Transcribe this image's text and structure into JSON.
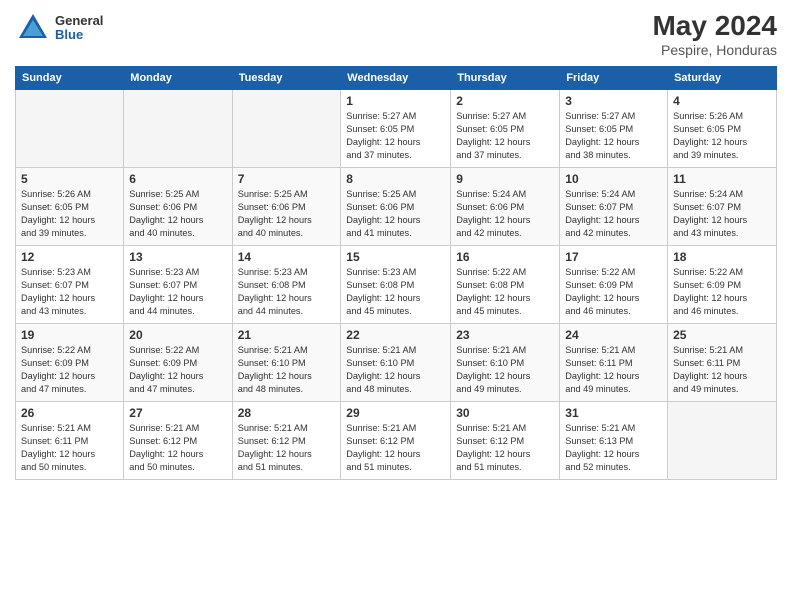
{
  "header": {
    "logo": {
      "general": "General",
      "blue": "Blue"
    },
    "title": "May 2024",
    "location": "Pespire, Honduras"
  },
  "weekdays": [
    "Sunday",
    "Monday",
    "Tuesday",
    "Wednesday",
    "Thursday",
    "Friday",
    "Saturday"
  ],
  "weeks": [
    [
      {
        "day": "",
        "info": ""
      },
      {
        "day": "",
        "info": ""
      },
      {
        "day": "",
        "info": ""
      },
      {
        "day": "1",
        "info": "Sunrise: 5:27 AM\nSunset: 6:05 PM\nDaylight: 12 hours\nand 37 minutes."
      },
      {
        "day": "2",
        "info": "Sunrise: 5:27 AM\nSunset: 6:05 PM\nDaylight: 12 hours\nand 37 minutes."
      },
      {
        "day": "3",
        "info": "Sunrise: 5:27 AM\nSunset: 6:05 PM\nDaylight: 12 hours\nand 38 minutes."
      },
      {
        "day": "4",
        "info": "Sunrise: 5:26 AM\nSunset: 6:05 PM\nDaylight: 12 hours\nand 39 minutes."
      }
    ],
    [
      {
        "day": "5",
        "info": "Sunrise: 5:26 AM\nSunset: 6:05 PM\nDaylight: 12 hours\nand 39 minutes."
      },
      {
        "day": "6",
        "info": "Sunrise: 5:25 AM\nSunset: 6:06 PM\nDaylight: 12 hours\nand 40 minutes."
      },
      {
        "day": "7",
        "info": "Sunrise: 5:25 AM\nSunset: 6:06 PM\nDaylight: 12 hours\nand 40 minutes."
      },
      {
        "day": "8",
        "info": "Sunrise: 5:25 AM\nSunset: 6:06 PM\nDaylight: 12 hours\nand 41 minutes."
      },
      {
        "day": "9",
        "info": "Sunrise: 5:24 AM\nSunset: 6:06 PM\nDaylight: 12 hours\nand 42 minutes."
      },
      {
        "day": "10",
        "info": "Sunrise: 5:24 AM\nSunset: 6:07 PM\nDaylight: 12 hours\nand 42 minutes."
      },
      {
        "day": "11",
        "info": "Sunrise: 5:24 AM\nSunset: 6:07 PM\nDaylight: 12 hours\nand 43 minutes."
      }
    ],
    [
      {
        "day": "12",
        "info": "Sunrise: 5:23 AM\nSunset: 6:07 PM\nDaylight: 12 hours\nand 43 minutes."
      },
      {
        "day": "13",
        "info": "Sunrise: 5:23 AM\nSunset: 6:07 PM\nDaylight: 12 hours\nand 44 minutes."
      },
      {
        "day": "14",
        "info": "Sunrise: 5:23 AM\nSunset: 6:08 PM\nDaylight: 12 hours\nand 44 minutes."
      },
      {
        "day": "15",
        "info": "Sunrise: 5:23 AM\nSunset: 6:08 PM\nDaylight: 12 hours\nand 45 minutes."
      },
      {
        "day": "16",
        "info": "Sunrise: 5:22 AM\nSunset: 6:08 PM\nDaylight: 12 hours\nand 45 minutes."
      },
      {
        "day": "17",
        "info": "Sunrise: 5:22 AM\nSunset: 6:09 PM\nDaylight: 12 hours\nand 46 minutes."
      },
      {
        "day": "18",
        "info": "Sunrise: 5:22 AM\nSunset: 6:09 PM\nDaylight: 12 hours\nand 46 minutes."
      }
    ],
    [
      {
        "day": "19",
        "info": "Sunrise: 5:22 AM\nSunset: 6:09 PM\nDaylight: 12 hours\nand 47 minutes."
      },
      {
        "day": "20",
        "info": "Sunrise: 5:22 AM\nSunset: 6:09 PM\nDaylight: 12 hours\nand 47 minutes."
      },
      {
        "day": "21",
        "info": "Sunrise: 5:21 AM\nSunset: 6:10 PM\nDaylight: 12 hours\nand 48 minutes."
      },
      {
        "day": "22",
        "info": "Sunrise: 5:21 AM\nSunset: 6:10 PM\nDaylight: 12 hours\nand 48 minutes."
      },
      {
        "day": "23",
        "info": "Sunrise: 5:21 AM\nSunset: 6:10 PM\nDaylight: 12 hours\nand 49 minutes."
      },
      {
        "day": "24",
        "info": "Sunrise: 5:21 AM\nSunset: 6:11 PM\nDaylight: 12 hours\nand 49 minutes."
      },
      {
        "day": "25",
        "info": "Sunrise: 5:21 AM\nSunset: 6:11 PM\nDaylight: 12 hours\nand 49 minutes."
      }
    ],
    [
      {
        "day": "26",
        "info": "Sunrise: 5:21 AM\nSunset: 6:11 PM\nDaylight: 12 hours\nand 50 minutes."
      },
      {
        "day": "27",
        "info": "Sunrise: 5:21 AM\nSunset: 6:12 PM\nDaylight: 12 hours\nand 50 minutes."
      },
      {
        "day": "28",
        "info": "Sunrise: 5:21 AM\nSunset: 6:12 PM\nDaylight: 12 hours\nand 51 minutes."
      },
      {
        "day": "29",
        "info": "Sunrise: 5:21 AM\nSunset: 6:12 PM\nDaylight: 12 hours\nand 51 minutes."
      },
      {
        "day": "30",
        "info": "Sunrise: 5:21 AM\nSunset: 6:12 PM\nDaylight: 12 hours\nand 51 minutes."
      },
      {
        "day": "31",
        "info": "Sunrise: 5:21 AM\nSunset: 6:13 PM\nDaylight: 12 hours\nand 52 minutes."
      },
      {
        "day": "",
        "info": ""
      }
    ]
  ]
}
